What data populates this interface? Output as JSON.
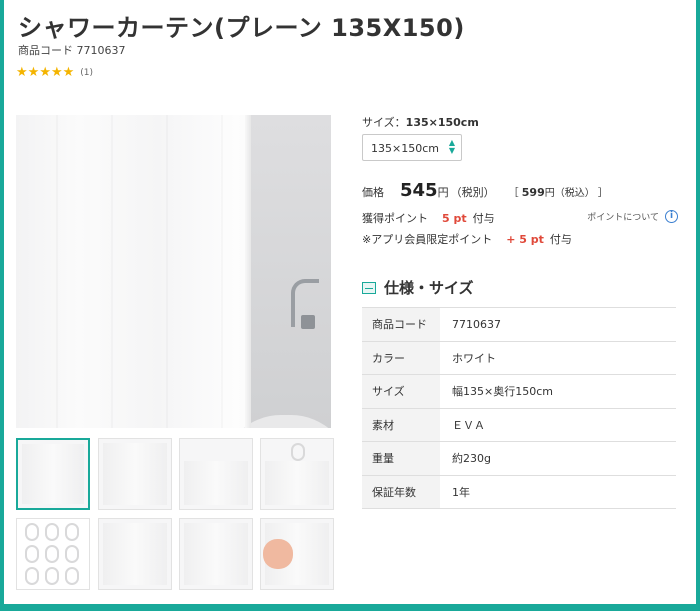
{
  "product": {
    "title": "シャワーカーテン(プレーン 135X150)",
    "code_line": "商品コード 7710637",
    "stars": [
      "★",
      "★",
      "★",
      "★",
      "★"
    ],
    "rating_count": "(1)"
  },
  "size": {
    "label_prefix": "サイズ：",
    "label_value": "135×150cm",
    "selected": "135×150cm"
  },
  "price": {
    "label": "価格",
    "amount": "545",
    "yen": "円",
    "tax_excluded": "（税別）",
    "incl_open": "［",
    "incl_amount": "599",
    "incl_suffix": "円（税込）",
    "incl_close": "］"
  },
  "points": {
    "label": "獲得ポイント",
    "value": "5 pt",
    "suffix": "付与",
    "about_label": "ポイントについて"
  },
  "app_points": {
    "label": "※アプリ会員限定ポイント",
    "value": "+ 5 pt",
    "suffix": "付与"
  },
  "specs": {
    "title": "仕様・サイズ",
    "rows": [
      {
        "key": "商品コード",
        "value": "7710637"
      },
      {
        "key": "カラー",
        "value": "ホワイト"
      },
      {
        "key": "サイズ",
        "value": "幅135×奥行150cm"
      },
      {
        "key": "素材",
        "value": "ＥＶＡ"
      },
      {
        "key": "重量",
        "value": "約230g"
      },
      {
        "key": "保証年数",
        "value": "1年"
      }
    ]
  },
  "colors": {
    "accent": "#19a99a",
    "point_red": "#e0493a",
    "star": "#f4b400"
  }
}
